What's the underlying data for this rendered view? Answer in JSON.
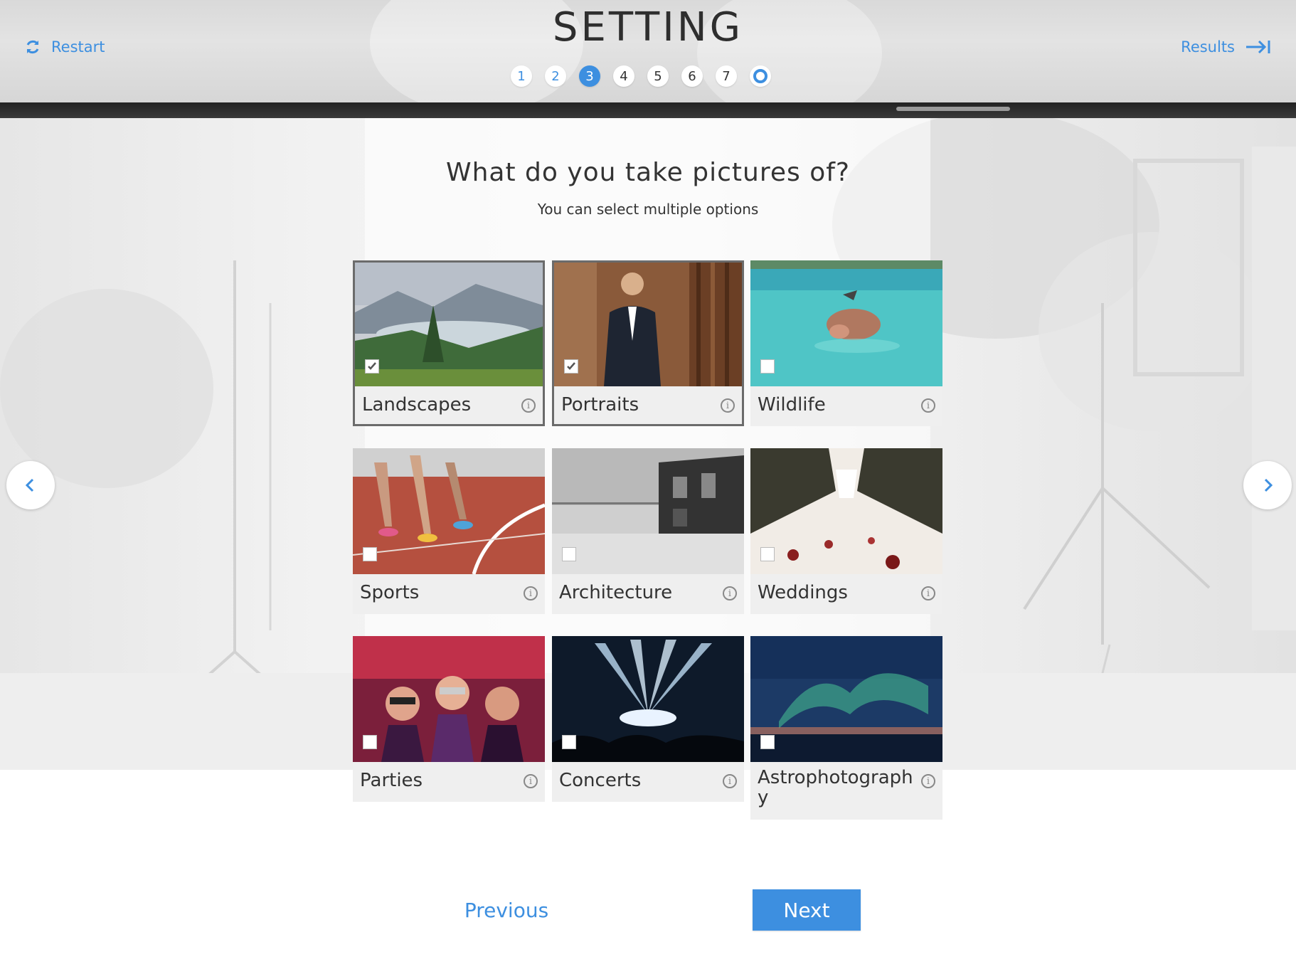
{
  "header": {
    "restart_label": "Restart",
    "results_label": "Results",
    "title": "SETTING",
    "steps": [
      "1",
      "2",
      "3",
      "4",
      "5",
      "6",
      "7"
    ],
    "current_step": "3",
    "accent_color": "#3d8fe0"
  },
  "question": {
    "title": "What do you take pictures of?",
    "subtitle": "You can select multiple options"
  },
  "options": [
    {
      "label": "Landscapes",
      "selected": true,
      "icon": "mountain-lake-photo"
    },
    {
      "label": "Portraits",
      "selected": true,
      "icon": "man-in-suit-photo"
    },
    {
      "label": "Wildlife",
      "selected": false,
      "icon": "swimming-pig-photo"
    },
    {
      "label": "Sports",
      "selected": false,
      "icon": "runners-track-photo"
    },
    {
      "label": "Architecture",
      "selected": false,
      "icon": "pier-building-photo"
    },
    {
      "label": "Weddings",
      "selected": false,
      "icon": "wedding-aisle-photo"
    },
    {
      "label": "Parties",
      "selected": false,
      "icon": "masked-party-photo"
    },
    {
      "label": "Concerts",
      "selected": false,
      "icon": "concert-stage-photo"
    },
    {
      "label": "Astrophotography",
      "selected": false,
      "icon": "aurora-photo"
    }
  ],
  "nav": {
    "previous_label": "Previous",
    "next_label": "Next"
  }
}
